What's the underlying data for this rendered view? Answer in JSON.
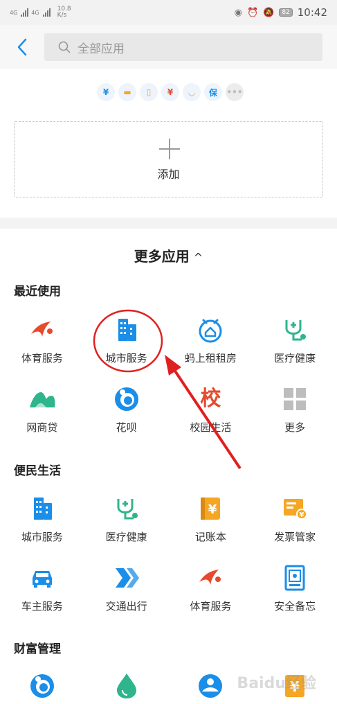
{
  "status_bar": {
    "signal_labels": [
      "4G",
      "4G"
    ],
    "speed": "10.8",
    "speed_unit": "K/s",
    "battery": "82",
    "time": "10:42"
  },
  "header": {
    "search_placeholder": "全部应用"
  },
  "favorites": {
    "mini_icons": [
      {
        "icon": "yuan-circle-icon",
        "glyph": "¥",
        "color": "#1a8ee8"
      },
      {
        "icon": "card-icon",
        "glyph": "▬",
        "color": "#f5a623"
      },
      {
        "icon": "phone-icon",
        "glyph": "▯",
        "color": "#f5a623"
      },
      {
        "icon": "money-bag-icon",
        "glyph": "¥",
        "color": "#e64a2e"
      },
      {
        "icon": "cup-icon",
        "glyph": "◡",
        "color": "#f5a623"
      },
      {
        "icon": "shield-icon",
        "glyph": "保",
        "color": "#1a8ee8"
      },
      {
        "icon": "more-dots-icon",
        "glyph": "•••",
        "color": "#bdbdbd"
      }
    ],
    "add_label": "添加"
  },
  "more_apps": {
    "title": "更多应用",
    "caret": "^",
    "sections": [
      {
        "title": "最近使用",
        "apps": [
          {
            "label": "体育服务",
            "icon": "sports-icon"
          },
          {
            "label": "城市服务",
            "icon": "city-icon"
          },
          {
            "label": "蚂上租租房",
            "icon": "house-icon"
          },
          {
            "label": "医疗健康",
            "icon": "medical-icon"
          },
          {
            "label": "网商贷",
            "icon": "mountain-icon"
          },
          {
            "label": "花呗",
            "icon": "huabei-icon"
          },
          {
            "label": "校园生活",
            "icon": "campus-icon",
            "glyph": "校"
          },
          {
            "label": "更多",
            "icon": "grid-more-icon"
          }
        ]
      },
      {
        "title": "便民生活",
        "apps": [
          {
            "label": "城市服务",
            "icon": "city-icon"
          },
          {
            "label": "医疗健康",
            "icon": "medical-icon"
          },
          {
            "label": "记账本",
            "icon": "ledger-icon",
            "glyph": "¥"
          },
          {
            "label": "发票管家",
            "icon": "invoice-icon"
          },
          {
            "label": "车主服务",
            "icon": "car-icon"
          },
          {
            "label": "交通出行",
            "icon": "transport-icon"
          },
          {
            "label": "体育服务",
            "icon": "sports-icon"
          },
          {
            "label": "安全备忘",
            "icon": "safe-icon"
          }
        ]
      },
      {
        "title": "财富管理",
        "apps": [
          {
            "label": "",
            "icon": "huabei-icon"
          },
          {
            "label": "",
            "icon": "drop-icon"
          },
          {
            "label": "",
            "icon": "fund-icon"
          },
          {
            "label": "",
            "icon": "yuan-icon",
            "glyph": "¥"
          }
        ]
      }
    ]
  },
  "watermark": "Baidu经验",
  "colors": {
    "blue": "#1a8ee8",
    "red": "#e64a2e",
    "green": "#2eb58c",
    "orange": "#f5a623",
    "gray": "#bdbdbd"
  }
}
